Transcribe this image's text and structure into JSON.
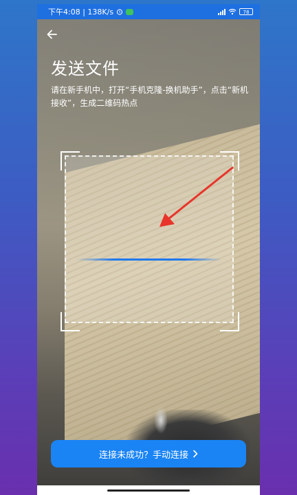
{
  "status_bar": {
    "time_speed": "下午4:08 | 138K/s",
    "battery": "78",
    "icons": [
      "alarm-icon",
      "wechat-icon",
      "signal-icon",
      "wifi-icon",
      "battery-icon"
    ]
  },
  "header": {
    "back_icon": "back-arrow-icon",
    "title": "发送文件",
    "description": "请在新手机中，打开“手机克隆-换机助手”，点击“新机接收”，生成二维码热点"
  },
  "scanner": {
    "line_color": "#1e78f0",
    "annotation_color": "#e8352b"
  },
  "footer": {
    "manual_connect_label": "连接未成功？手动连接",
    "button_color": "#1a84f5"
  }
}
